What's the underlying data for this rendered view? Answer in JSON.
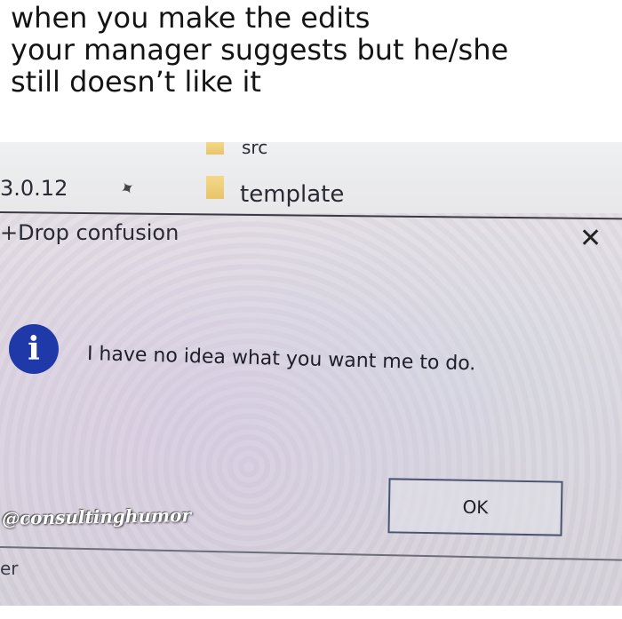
{
  "caption": {
    "line1": "when you make the edits",
    "line2": "your manager suggests but he/she",
    "line3": "still doesn’t like it"
  },
  "background_window": {
    "folder_top": "src",
    "version": "3.0.12",
    "folder_label": "template",
    "tab_title": "+Drop confusion",
    "bottom_fragment": "er"
  },
  "dialog": {
    "info_icon_glyph": "i",
    "close_glyph": "✕",
    "message": "I have no idea what you want me to do.",
    "ok_label": "OK"
  },
  "watermark": "@consultinghumor",
  "colors": {
    "info_icon": "#1f3aa8",
    "text": "#1e1e28"
  }
}
